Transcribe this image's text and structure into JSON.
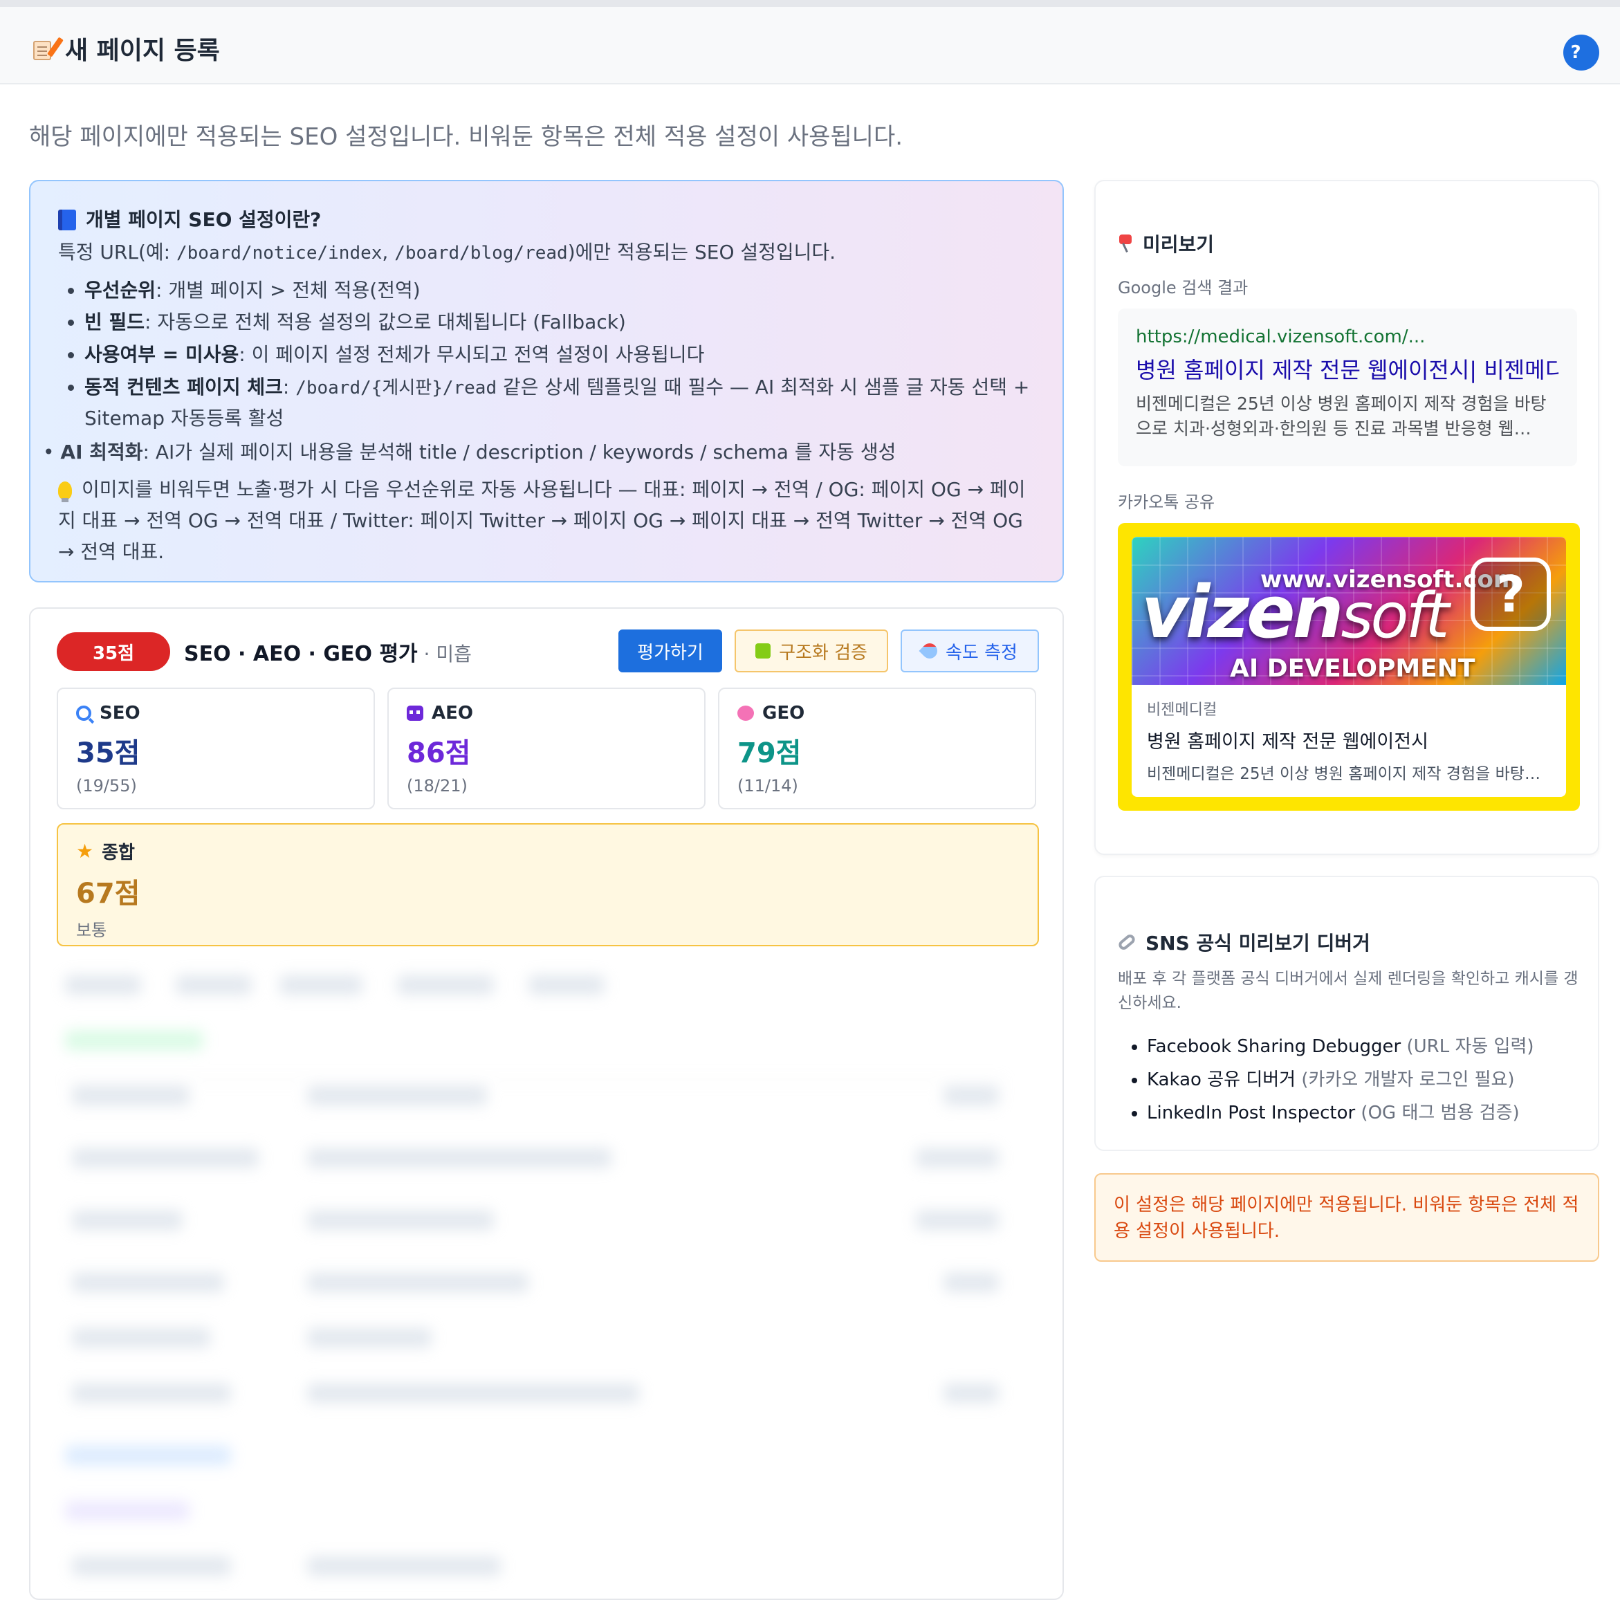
{
  "header": {
    "title": "새 페이지 등록",
    "help_label": "?"
  },
  "subtitle": "해당 페이지에만 적용되는 SEO 설정입니다. 비워둔 항목은 전체 적용 설정이 사용됩니다.",
  "info": {
    "heading": "개별 페이지 SEO 설정이란?",
    "intro_prefix": "특정 URL(예: ",
    "intro_code1": "/board/notice/index",
    "intro_sep": ", ",
    "intro_code2": "/board/blog/read",
    "intro_suffix": ")에만 적용되는 SEO 설정입니다.",
    "items": [
      {
        "label": "우선순위",
        "text": ": 개별 페이지 > 전체 적용(전역)"
      },
      {
        "label": "빈 필드",
        "text": ": 자동으로 전체 적용 설정의 값으로 대체됩니다 (Fallback)"
      },
      {
        "label": "사용여부 = 미사용",
        "text": ": 이 페이지 설정 전체가 무시되고 전역 설정이 사용됩니다"
      },
      {
        "label": "동적 컨텐츠 페이지 체크",
        "text_pre": ": ",
        "code": "/board/{게시판}/read",
        "text": " 같은 상세 템플릿일 때 필수 — AI 최적화 시 샘플 글 자동 선택 + Sitemap 자동등록 활성"
      }
    ],
    "ai_label": "AI 최적화",
    "ai_text": ": AI가 실제 페이지 내용을 분석해 title / description / keywords / schema 를 자동 생성",
    "tip": "이미지를 비워두면 노출·평가 시 다음 우선순위로 자동 사용됩니다 — 대표: 페이지 → 전역 / OG: 페이지 OG → 페이지 대표 → 전역 OG → 전역 대표 / Twitter: 페이지 Twitter → 페이지 OG → 페이지 대표 → 전역 Twitter → 전역 OG → 전역 대표."
  },
  "evaluation": {
    "score_badge": "35점",
    "title": "SEO · AEO · GEO 평가",
    "grade": " · 미흡",
    "buttons": {
      "evaluate": "평가하기",
      "structure": "구조화 검증",
      "speed": "속도 측정"
    },
    "metrics": [
      {
        "name": "SEO",
        "score": "35점",
        "detail": "(19/55)",
        "color": "#1e3a8a",
        "icon": "search-icon"
      },
      {
        "name": "AEO",
        "score": "86점",
        "detail": "(18/21)",
        "color": "#6d28d9",
        "icon": "robot-icon"
      },
      {
        "name": "GEO",
        "score": "79점",
        "detail": "(11/14)",
        "color": "#0d9488",
        "icon": "brain-icon"
      }
    ],
    "total": {
      "name": "종합",
      "score": "67점",
      "grade": "보통"
    }
  },
  "preview": {
    "title": "미리보기",
    "google_label": "Google 검색 결과",
    "google": {
      "url": "https://medical.vizensoft.com/...",
      "title": "병원 홈페이지 제작 전문 웹에이전시| 비젠메디컬",
      "description": "비젠메디컬은 25년 이상 병원 홈페이지 제작 경험을 바탕으로 치과·성형외과·한의원 등 진료 과목별 반응형 웹…"
    },
    "kakao_label": "카카오톡 공유",
    "kakao": {
      "image_domain": "www.vizensoft.com",
      "image_brand_a": "vizen",
      "image_brand_b": "soft",
      "image_sub": "AI DEVELOPMENT",
      "image_bubble": "?",
      "site": "비젠메디컬",
      "title": "병원 홈페이지 제작 전문 웹에이전시",
      "description": "비젠메디컬은 25년 이상 병원 홈페이지 제작 경험을 바탕…"
    }
  },
  "sns": {
    "title": "SNS 공식 미리보기 디버거",
    "description": "배포 후 각 플랫폼 공식 디버거에서 실제 렌더링을 확인하고 캐시를 갱신하세요.",
    "links": [
      {
        "name": "Facebook Sharing Debugger",
        "note": " (URL 자동 입력)"
      },
      {
        "name": "Kakao 공유 디버거",
        "note": " (카카오 개발자 로그인 필요)"
      },
      {
        "name": "LinkedIn Post Inspector",
        "note": " (OG 태그 범용 검증)"
      }
    ]
  },
  "notice": "이 설정은 해당 페이지에만 적용됩니다. 비워둔 항목은 전체 적용 설정이 사용됩니다.",
  "colors": {
    "accent": "#1d6fde",
    "score_bad": "#dc2626",
    "total_border": "#f6c343",
    "kakao": "#fee500",
    "notice_text": "#d9480f"
  }
}
